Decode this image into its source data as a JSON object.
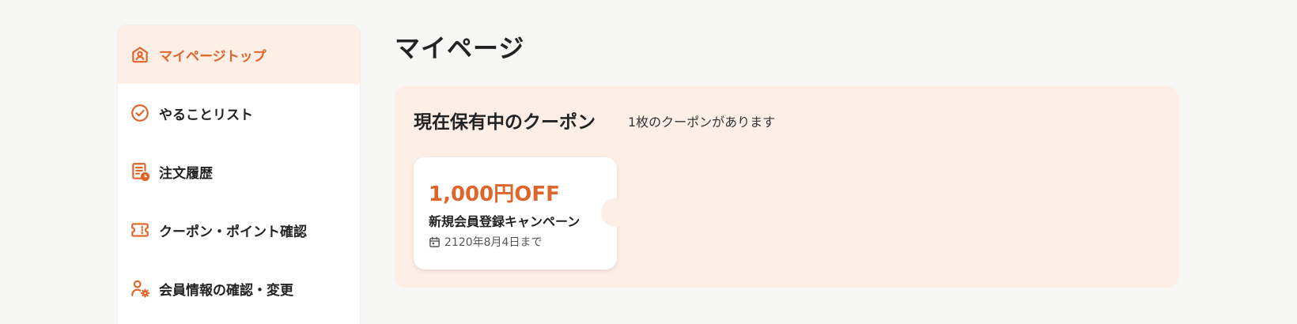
{
  "colors": {
    "accent": "#e0652b",
    "active_bg": "#fdefe6",
    "panel_bg": "#fdefe6",
    "page_bg": "#f7f7f5",
    "text": "#222222"
  },
  "sidebar": {
    "items": [
      {
        "label": "マイページトップ",
        "icon": "home-icon",
        "active": true
      },
      {
        "label": "やることリスト",
        "icon": "check-circle-icon",
        "active": false
      },
      {
        "label": "注文履歴",
        "icon": "order-history-icon",
        "active": false
      },
      {
        "label": "クーポン・ポイント確認",
        "icon": "ticket-icon",
        "active": false
      },
      {
        "label": "会員情報の確認・変更",
        "icon": "user-settings-icon",
        "active": false
      }
    ]
  },
  "main": {
    "title": "マイページ",
    "coupons": {
      "heading": "現在保有中のクーポン",
      "count_text": "1枚のクーポンがあります",
      "items": [
        {
          "amount": "1,000円OFF",
          "name": "新規会員登録キャンペーン",
          "expiry": "2120年8月4日まで",
          "expiry_icon": "calendar-icon"
        }
      ]
    }
  }
}
